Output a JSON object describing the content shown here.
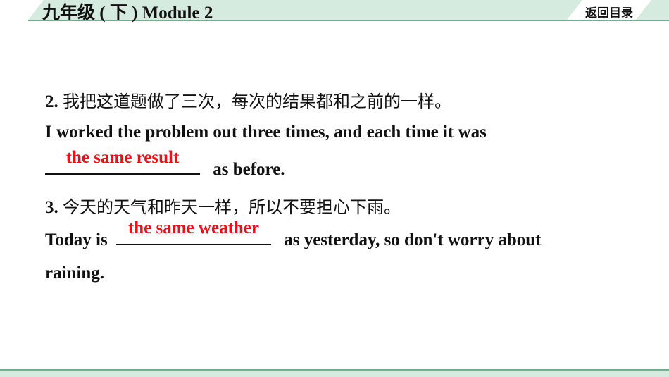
{
  "header": {
    "title": "九年级 ( 下 ) Module 2",
    "return_label": "返回目录"
  },
  "colors": {
    "accent_band": "#d6ebe0",
    "accent_line": "#6fb08e",
    "answer": "#e8101a"
  },
  "questions": [
    {
      "number": "2.",
      "chinese": "我把这道题做了三次，每次的结果都和之前的一样。",
      "line1": "I worked the problem out three times, and each time it was",
      "answer": "the same result",
      "after_blank": "as before."
    },
    {
      "number": "3.",
      "chinese": "今天的天气和昨天一样，所以不要担心下雨。",
      "before_blank": "Today is",
      "answer": "the same weather",
      "after_blank": "as yesterday, so don't worry about",
      "line3": "raining."
    }
  ]
}
